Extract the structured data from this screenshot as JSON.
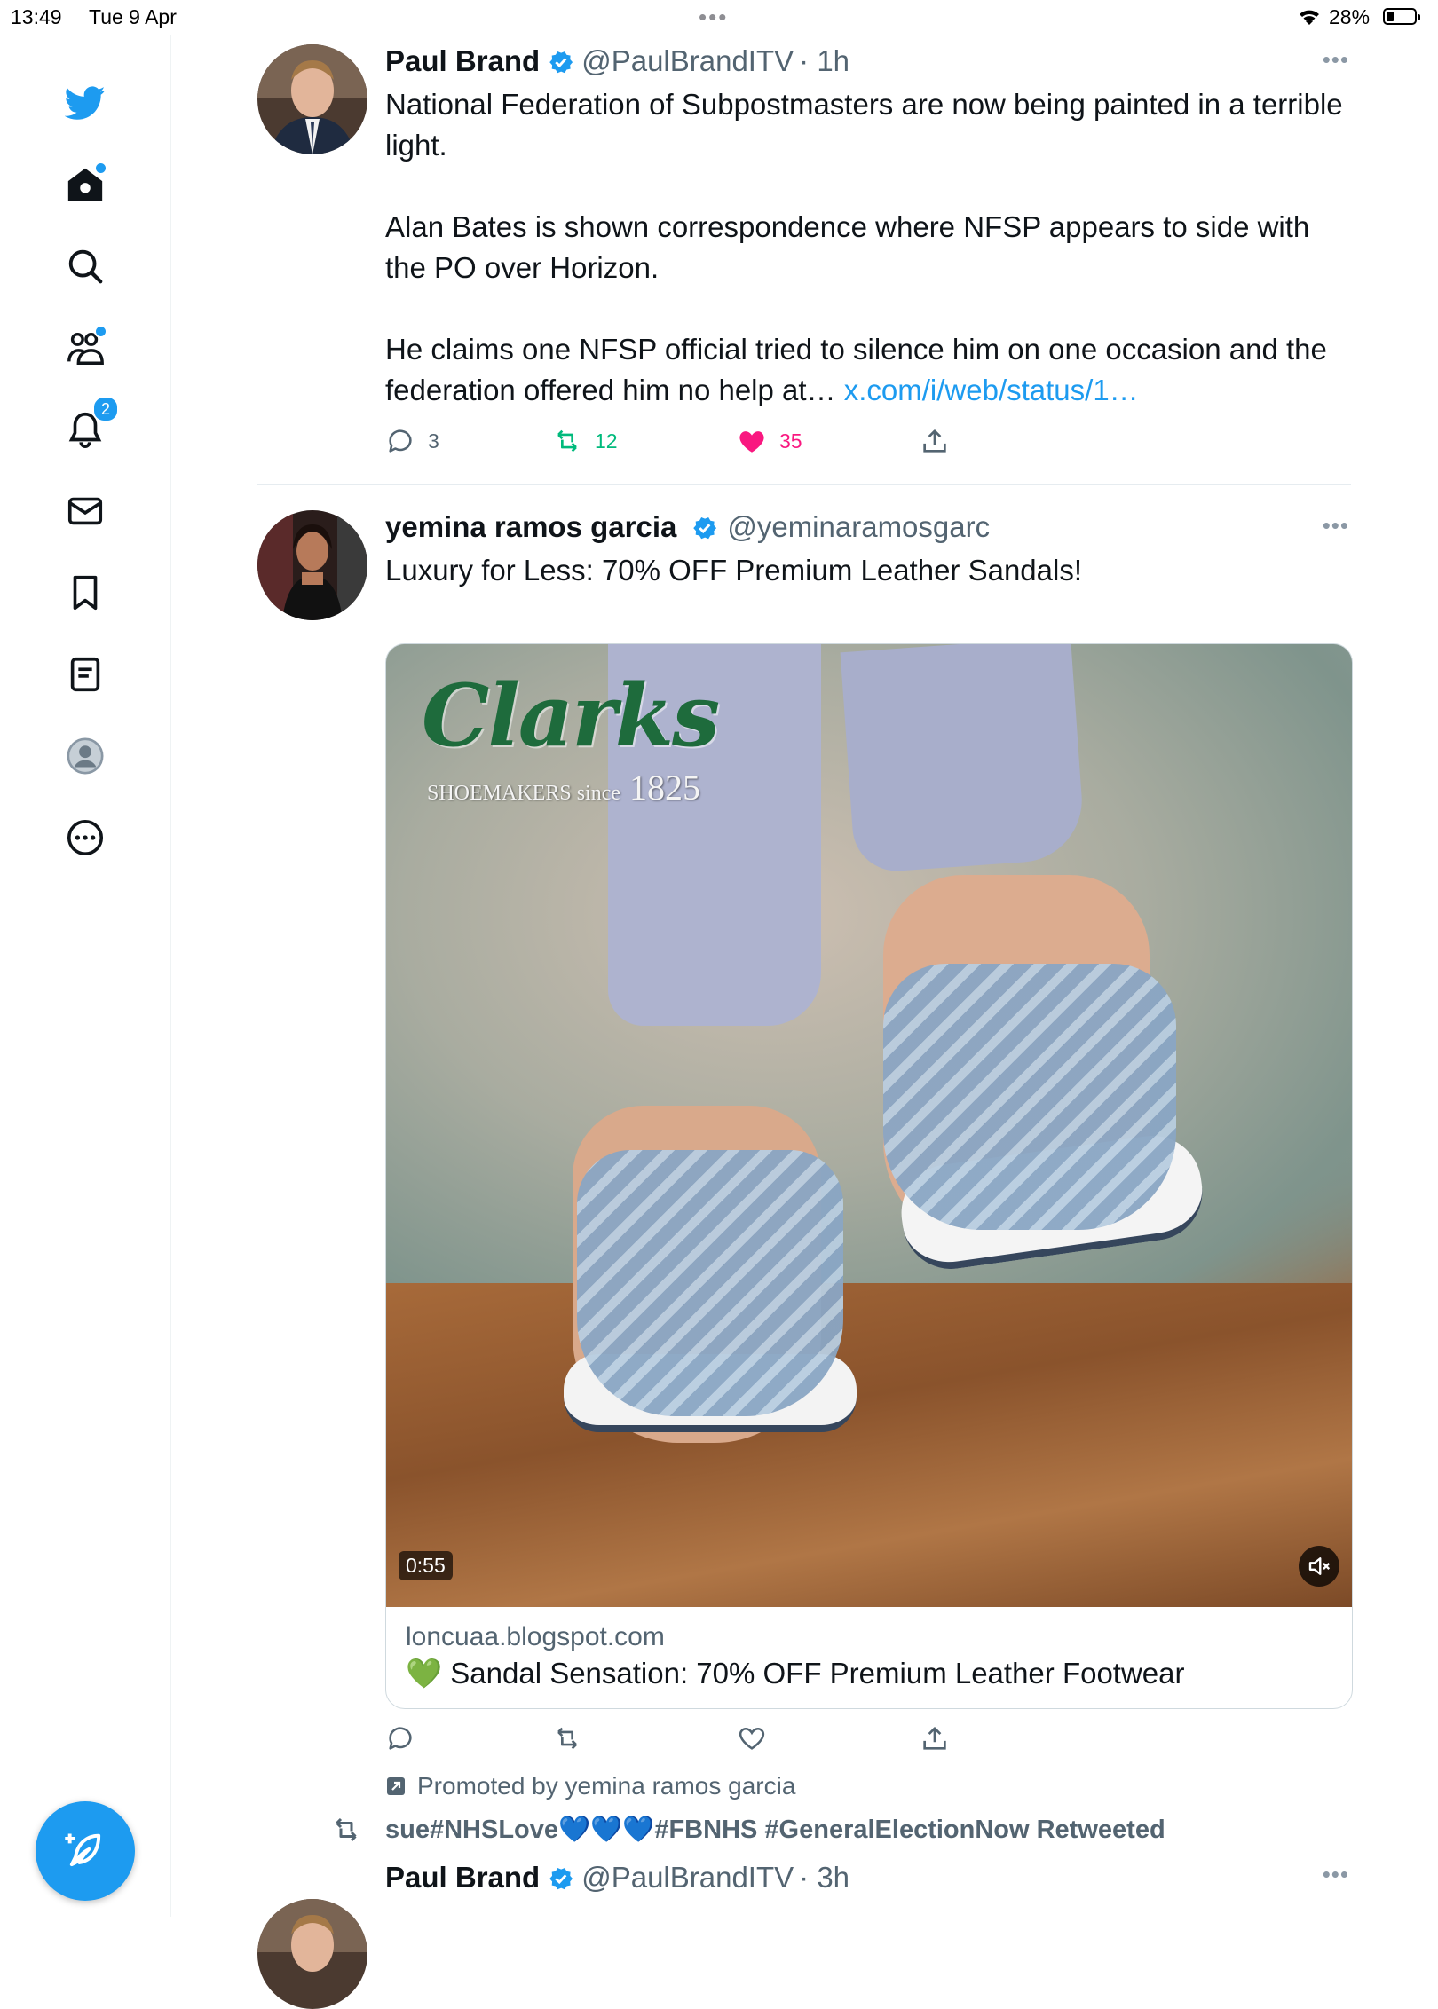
{
  "status_bar": {
    "time": "13:49",
    "date": "Tue 9 Apr",
    "battery": "28%"
  },
  "sidebar": {
    "notifications_count": "2",
    "icons": [
      "twitter-bird-icon",
      "home-icon",
      "search-icon",
      "communities-icon",
      "bell-icon",
      "mail-icon",
      "bookmark-icon",
      "lists-icon",
      "profile-icon",
      "more-circle-icon",
      "compose-icon"
    ],
    "accent": "#1d9bf0"
  },
  "feed": {
    "tweet1": {
      "name": "Paul Brand",
      "handle": "@PaulBrandITV",
      "time": "· 1h",
      "paragraphs": [
        "National Federation of Subpostmasters are now being painted in a terrible light.",
        "Alan Bates is shown correspondence where NFSP appears to side with the PO over Horizon.",
        "He claims one NFSP official tried to silence him on one occasion and the federation offered him no help at…"
      ],
      "link": "x.com/i/web/status/1…",
      "replies": "3",
      "retweets": "12",
      "likes": "35"
    },
    "tweet2": {
      "name": "yemina ramos garcia",
      "handle": "@yeminaramosgarc",
      "text": "Luxury for Less: 70% OFF Premium Leather Sandals!",
      "video_brand": "Clarks",
      "video_tagline": "SHOEMAKERS since",
      "video_year": "1825",
      "duration": "0:55",
      "card_domain": "loncuaa.blogspot.com",
      "card_emoji": "💚",
      "card_title": "Sandal Sensation: 70% OFF Premium Leather Footwear",
      "promoted": "Promoted by yemina ramos garcia"
    },
    "tweet3": {
      "retweeted_by": "sue#NHSLove",
      "retweeted_hearts": "💙💙💙",
      "retweeted_suffix": "#FBNHS #GeneralElectionNow Retweeted",
      "name": "Paul Brand",
      "handle": "@PaulBrandITV",
      "time": "· 3h"
    }
  }
}
